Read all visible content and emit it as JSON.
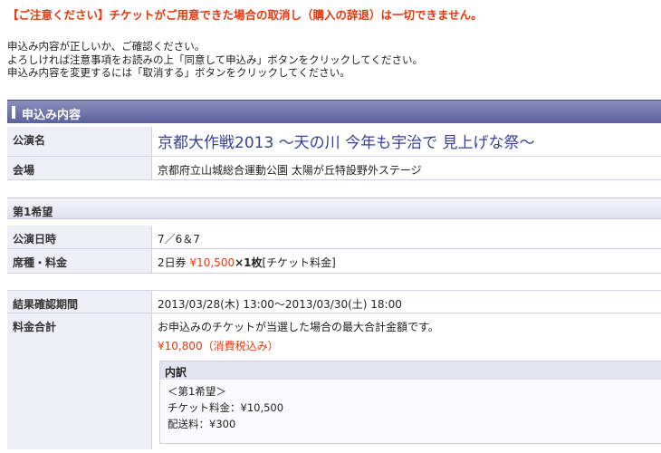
{
  "warning": "【ご注意ください】チケットがご用意できた場合の取消し（購入の辞退）は一切できません。",
  "intro": [
    "申込み内容が正しいか、ご確認ください。",
    "よろしければ注意事項をお読みの上「同意して申込み」ボタンをクリックしてください。",
    "申込み内容を変更するには「取消する」ボタンをクリックしてください。"
  ],
  "section_title": "申込み内容",
  "performance": {
    "label": "公演名",
    "value": "京都大作戦2013 ～天の川 今年も宇治で 見上げな祭～"
  },
  "venue": {
    "label": "会場",
    "value": "京都府立山城総合運動公園 太陽が丘特設野外ステージ"
  },
  "choice_title": "第1希望",
  "date": {
    "label": "公演日時",
    "value": "7／6＆7"
  },
  "seat": {
    "label": "席種・料金",
    "ticket_type": "2日券",
    "price": "¥10,500",
    "qty": "×1枚",
    "note": "[チケット料金]"
  },
  "result_period": {
    "label": "結果確認期間",
    "value": "2013/03/28(木) 13:00～2013/03/30(土) 18:00"
  },
  "total": {
    "label": "料金合計",
    "description": "お申込みのチケットが当選した場合の最大合計金額です。",
    "amount": "¥10,800",
    "tax_note": "（消費税込み）"
  },
  "breakdown": {
    "title": "内訳",
    "lines": [
      "＜第1希望＞",
      "チケット料金：¥10,500",
      "配送料：¥300"
    ]
  }
}
